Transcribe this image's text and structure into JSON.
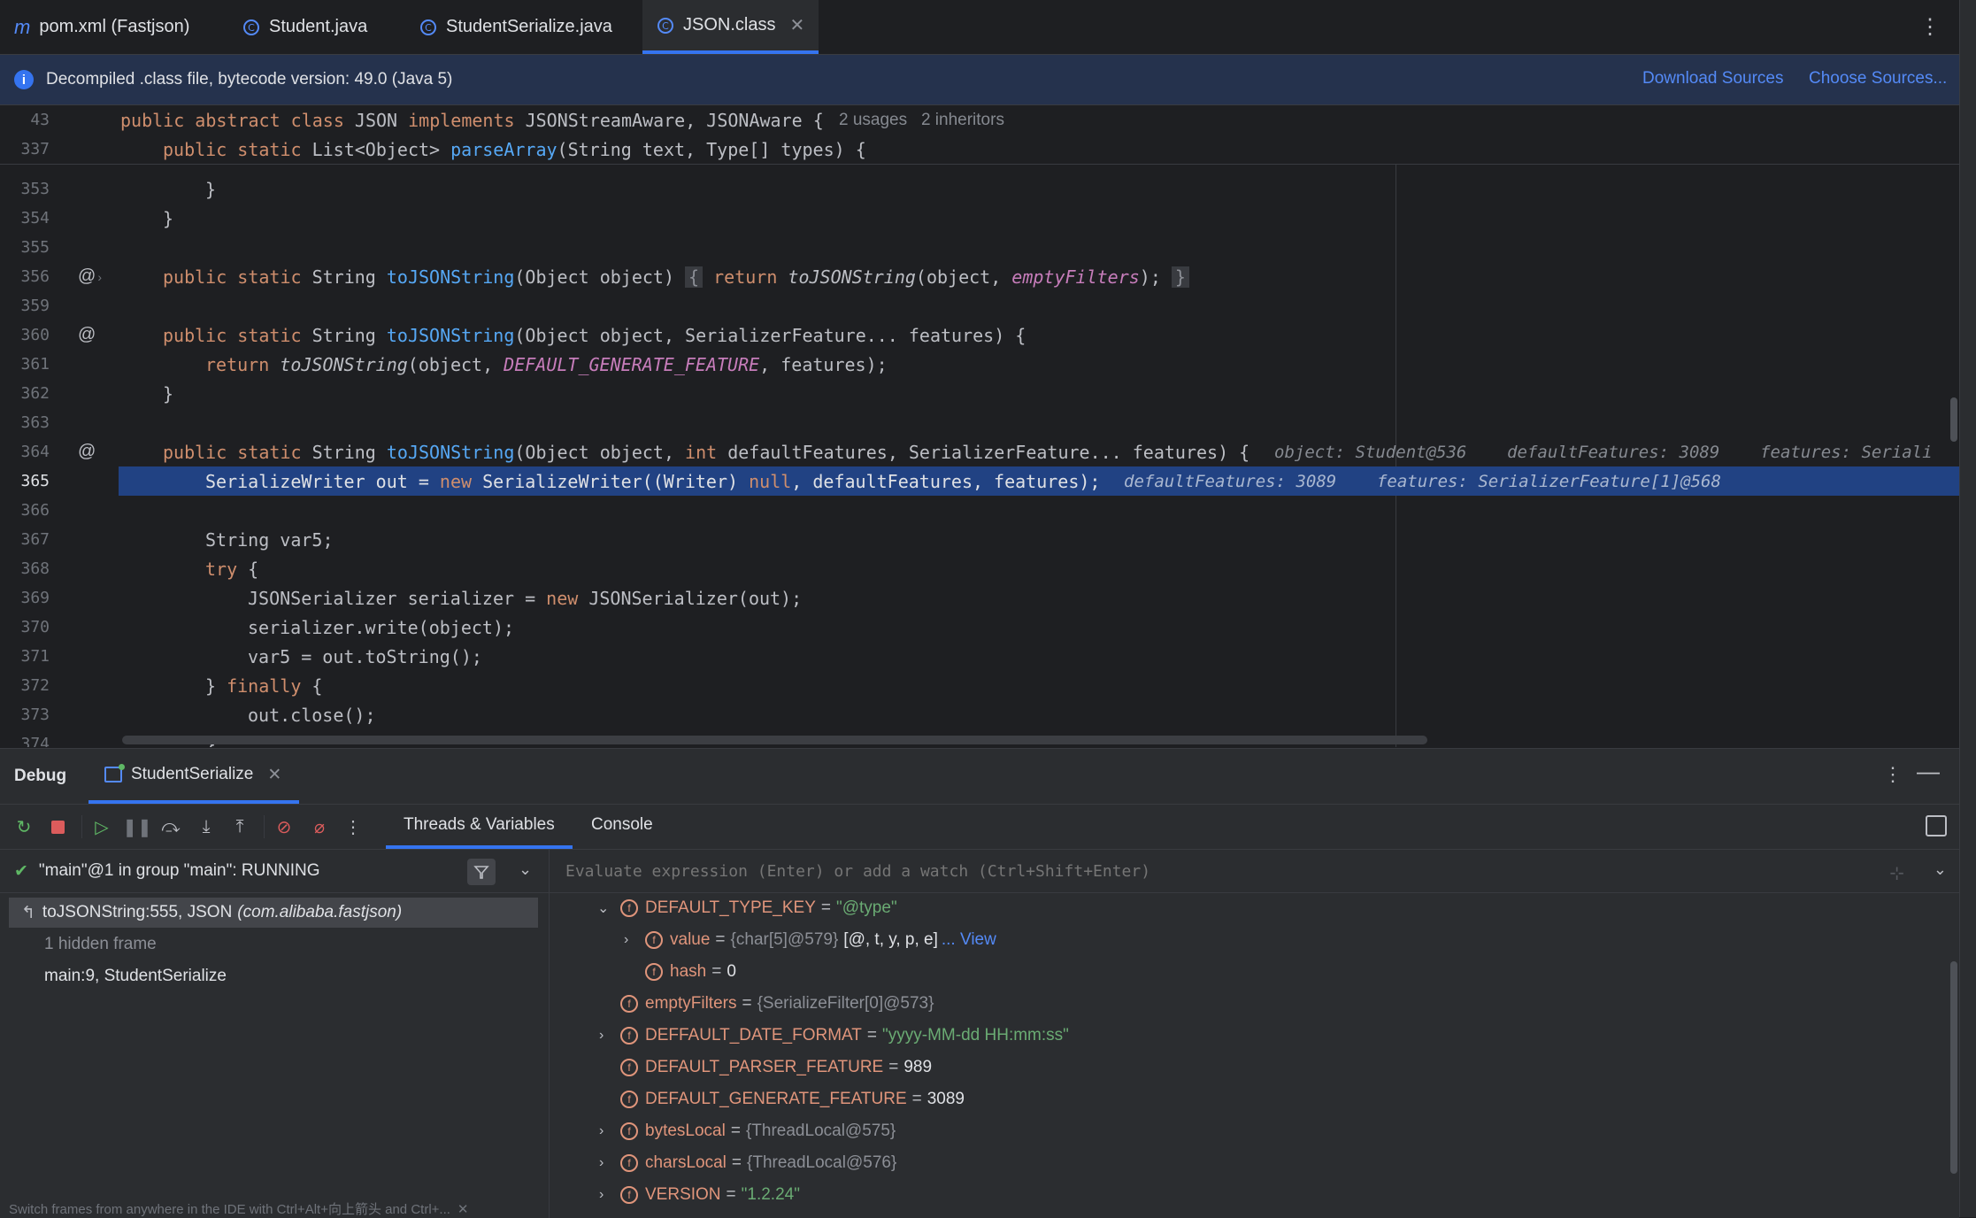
{
  "tabs": [
    {
      "label": "pom.xml (Fastjson)",
      "icon": "maven-icon"
    },
    {
      "label": "Student.java",
      "icon": "java-class-icon"
    },
    {
      "label": "StudentSerialize.java",
      "icon": "java-class-icon"
    },
    {
      "label": "JSON.class",
      "icon": "java-class-icon",
      "active": true
    }
  ],
  "banner": {
    "text": "Decompiled .class file, bytecode version: 49.0 (Java 5)",
    "download_sources": "Download Sources",
    "choose_sources": "Choose Sources..."
  },
  "editor": {
    "sticky": [
      {
        "num": "43",
        "code": "public abstract class JSON implements JSONStreamAware, JSONAware {",
        "hint": "2 usages   2 inheritors"
      },
      {
        "num": "337",
        "code": "public static List<Object> parseArray(String text, Type[] types) {"
      }
    ],
    "lines": [
      {
        "num": "353",
        "code": "}"
      },
      {
        "num": "354",
        "code": "}"
      },
      {
        "num": "355",
        "code": ""
      },
      {
        "num": "356",
        "code": "public static String toJSONString(Object object)",
        "fold_open": "{",
        "fold_body": " return toJSONString(object, emptyFilters); ",
        "fold_close": "}"
      },
      {
        "num": "359",
        "code": ""
      },
      {
        "num": "360",
        "code": "public static String toJSONString(Object object, SerializerFeature... features) {"
      },
      {
        "num": "361",
        "code": "return toJSONString(object, DEFAULT_GENERATE_FEATURE, features);"
      },
      {
        "num": "362",
        "code": "}"
      },
      {
        "num": "363",
        "code": ""
      },
      {
        "num": "364",
        "code": "public static String toJSONString(Object object, int defaultFeatures, SerializerFeature... features) {",
        "hint": "object: Student@536    defaultFeatures: 3089    features: Seriali"
      },
      {
        "num": "365",
        "code": "SerializeWriter out = new SerializeWriter((Writer) null, defaultFeatures, features);",
        "hint": "defaultFeatures: 3089    features: SerializerFeature[1]@568"
      },
      {
        "num": "366",
        "code": ""
      },
      {
        "num": "367",
        "code": "String var5;"
      },
      {
        "num": "368",
        "code": "try {"
      },
      {
        "num": "369",
        "code": "JSONSerializer serializer = new JSONSerializer(out);"
      },
      {
        "num": "370",
        "code": "serializer.write(object);"
      },
      {
        "num": "371",
        "code": "var5 = out.toString();"
      },
      {
        "num": "372",
        "code": "} finally {"
      },
      {
        "num": "373",
        "code": "out.close();"
      },
      {
        "num": "374",
        "code": "}"
      }
    ]
  },
  "debug": {
    "title": "Debug",
    "session": "StudentSerialize",
    "view_tabs": [
      "Threads & Variables",
      "Console"
    ],
    "thread": "\"main\"@1 in group \"main\": RUNNING",
    "frames": [
      {
        "label": "toJSONString:555, JSON",
        "pkg": "(com.alibaba.fastjson)"
      },
      {
        "label": "1 hidden frame"
      },
      {
        "label": "main:9, StudentSerialize"
      }
    ],
    "tip": "Switch frames from anywhere in the IDE with Ctrl+Alt+向上箭头 and Ctrl+...",
    "eval_placeholder": "Evaluate expression (Enter) or add a watch (Ctrl+Shift+Enter)",
    "variables": [
      {
        "name": "DEFAULT_TYPE_KEY",
        "value": "\"@type\""
      },
      {
        "name": "value",
        "ref": "{char[5]@579}",
        "value": "[@, t, y, p, e]",
        "link": "... View"
      },
      {
        "name": "hash",
        "value": "0"
      },
      {
        "name": "emptyFilters",
        "ref": "{SerializeFilter[0]@573}"
      },
      {
        "name": "DEFFAULT_DATE_FORMAT",
        "value": "\"yyyy-MM-dd HH:mm:ss\""
      },
      {
        "name": "DEFAULT_PARSER_FEATURE",
        "value": "989"
      },
      {
        "name": "DEFAULT_GENERATE_FEATURE",
        "value": "3089"
      },
      {
        "name": "bytesLocal",
        "ref": "{ThreadLocal@575}"
      },
      {
        "name": "charsLocal",
        "ref": "{ThreadLocal@576}"
      },
      {
        "name": "VERSION",
        "value": "\"1.2.24\""
      }
    ]
  },
  "colors": {
    "keyword": "#cf8e6d",
    "function": "#56a8f5",
    "constant": "#c77dbb",
    "string": "#6aab73",
    "current_line": "#214283",
    "accent": "#3574f0"
  }
}
